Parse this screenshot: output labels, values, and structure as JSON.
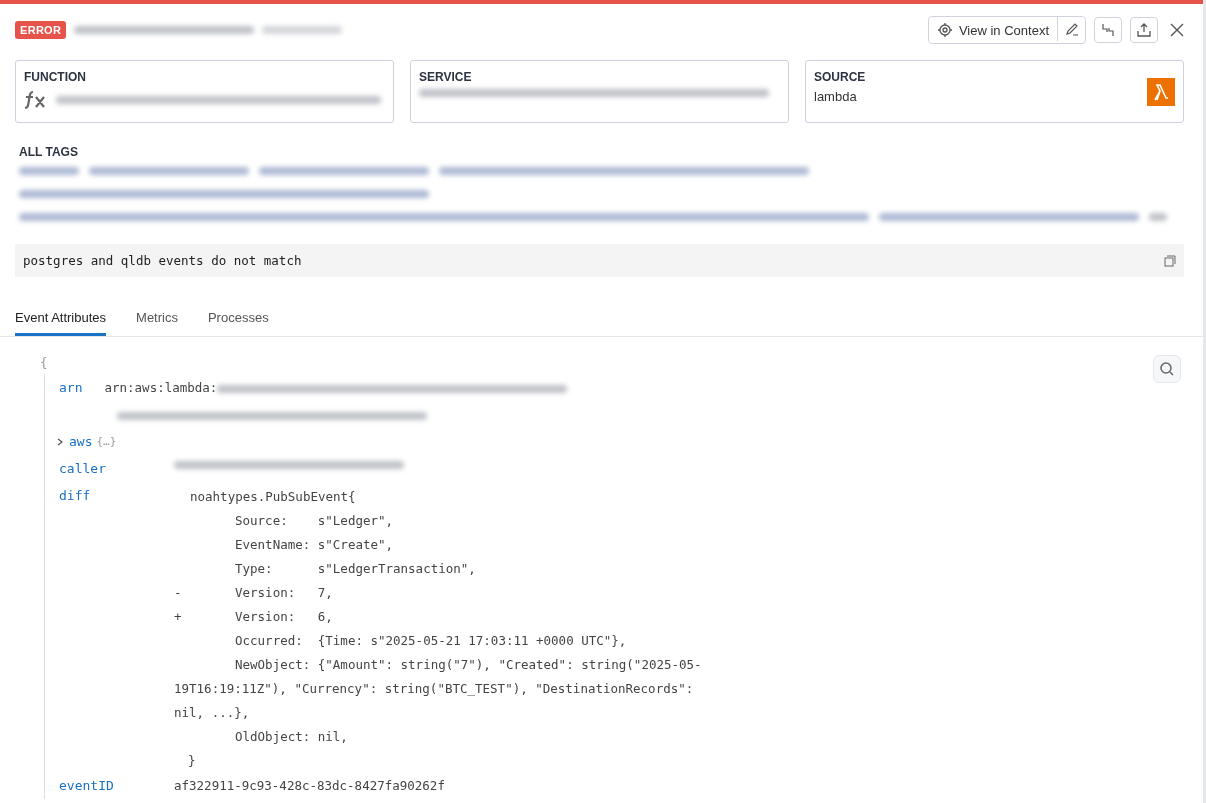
{
  "header": {
    "status": "ERROR",
    "actions": {
      "view_in_context": "View in Context"
    }
  },
  "cards": [
    {
      "kind": "function",
      "title": "FUNCTION"
    },
    {
      "kind": "service",
      "title": "SERVICE"
    },
    {
      "kind": "source",
      "title": "SOURCE",
      "value": "lambda"
    }
  ],
  "tags": {
    "title": "ALL TAGS"
  },
  "message": "postgres and qldb events do not match",
  "tabs": [
    {
      "label": "Event Attributes",
      "selected": true
    },
    {
      "label": "Metrics",
      "selected": false
    },
    {
      "label": "Processes",
      "selected": false
    }
  ],
  "attributes": {
    "open_brace": "{",
    "rows": [
      {
        "kind": "arn",
        "key": "arn",
        "value": "arn:aws:lambda:"
      },
      {
        "kind": "collapsed",
        "key": "aws",
        "value": "{…}",
        "expanded": false
      },
      {
        "kind": "redacted",
        "key": "caller"
      },
      {
        "kind": "diff",
        "key": "diff",
        "lines": [
          {
            "kind": "open",
            "text": "noahtypes.PubSubEvent{"
          },
          {
            "kind": "field",
            "text": "Source:    s\"Ledger\","
          },
          {
            "kind": "field",
            "text": "EventName: s\"Create\","
          },
          {
            "kind": "field",
            "text": "Type:      s\"LedgerTransaction\","
          },
          {
            "kind": "field",
            "marker": "-",
            "text": "Version:   7,"
          },
          {
            "kind": "field",
            "marker": "+",
            "text": "Version:   6,"
          },
          {
            "kind": "field",
            "text": "Occurred:  {Time: s\"2025-05-21 17:03:11 +0000 UTC\"},"
          },
          {
            "kind": "field",
            "text": "NewObject: {\"Amount\": string(\"7\"), \"Created\": string(\"2025-05-"
          },
          {
            "kind": "cont",
            "text": "19T16:19:11Z\"), \"Currency\": string(\"BTC_TEST\"), \"DestinationRecords\":"
          },
          {
            "kind": "cont",
            "text": "nil, ...},"
          },
          {
            "kind": "field",
            "text": "OldObject: nil,"
          },
          {
            "kind": "close",
            "text": "}"
          }
        ]
      },
      {
        "kind": "text",
        "key": "eventID",
        "value": "af322911-9c93-428c-83dc-8427fa90262f"
      }
    ]
  }
}
